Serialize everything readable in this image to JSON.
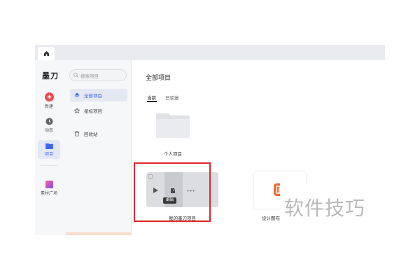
{
  "app": {
    "logo": "墨刀"
  },
  "rail": {
    "items": [
      {
        "label": "新建",
        "icon": "plus-circle-icon"
      },
      {
        "label": "动态",
        "icon": "clock-icon"
      },
      {
        "label": "项目",
        "icon": "folder-icon"
      },
      {
        "label": "素材广场",
        "icon": "gallery-icon"
      }
    ]
  },
  "search": {
    "placeholder": "搜索项目"
  },
  "nav": {
    "items": [
      {
        "label": "全部项目",
        "icon": "layers-icon"
      },
      {
        "label": "星标项目",
        "icon": "star-icon"
      },
      {
        "label": "回收站",
        "icon": "trash-icon"
      }
    ]
  },
  "main": {
    "title": "全部项目",
    "tabs": [
      {
        "label": "当前"
      },
      {
        "label": "已被归档",
        "display": "已驳迷"
      }
    ],
    "folder": {
      "label": "个人项目"
    },
    "cards": [
      {
        "label": "我的墨刀项目",
        "tooltip": "编辑"
      },
      {
        "label": "设计图布演示项目"
      }
    ]
  },
  "watermark": {
    "text": "软件技巧"
  },
  "colors": {
    "accent": "#3b64f2",
    "new_button": "#ef4b4b",
    "highlight": "#e0262b",
    "card_icon": "#f06a32"
  }
}
